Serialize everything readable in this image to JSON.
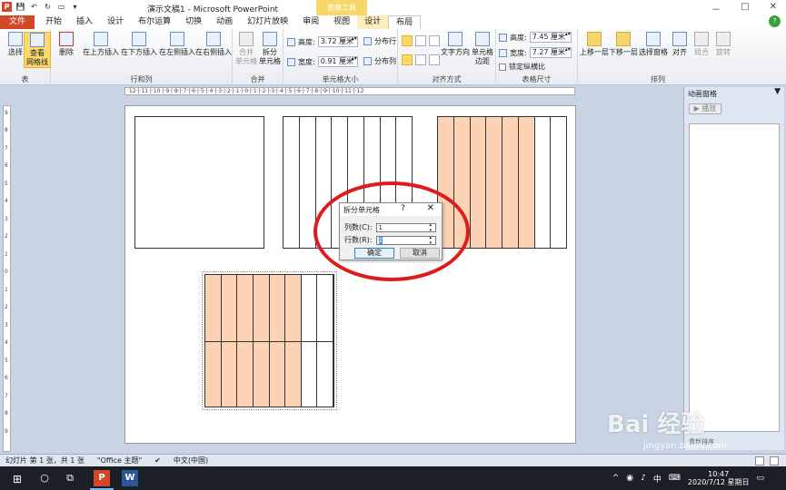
{
  "window": {
    "title": "演示文稿1 - Microsoft PowerPoint",
    "context_header": "表格工具",
    "min": "－",
    "max": "□",
    "close": "✕"
  },
  "tabs": [
    "开始",
    "插入",
    "设计",
    "布尔运算",
    "切换",
    "动画",
    "幻灯片放映",
    "审阅",
    "视图"
  ],
  "file_tab": "文件",
  "ctx_tabs": [
    "设计",
    "布局"
  ],
  "ribbon": {
    "table_group": {
      "label": "表",
      "select": "选择",
      "gridlines": "查看\n网格线"
    },
    "rowcol_group": {
      "label": "行和列",
      "delete": "删除",
      "insert_above": "在上方插入",
      "insert_below": "在下方插入",
      "insert_left": "在左侧插入",
      "insert_right": "在右侧插入"
    },
    "merge_group": {
      "label": "合并",
      "merge": "合并\n单元格",
      "split": "拆分\n单元格"
    },
    "cellsize_group": {
      "label": "单元格大小",
      "height_label": "高度:",
      "height_value": "3.72 厘米",
      "width_label": "宽度:",
      "width_value": "0.91 厘米",
      "distribute_rows": "分布行",
      "distribute_cols": "分布列"
    },
    "align_group": {
      "label": "对齐方式",
      "text_direction": "文字方向",
      "cell_margins": "单元格\n边距"
    },
    "tablesize_group": {
      "label": "表格尺寸",
      "height_label": "高度:",
      "height_value": "7.45 厘米",
      "width_label": "宽度:",
      "width_value": "7.27 厘米",
      "lock_ratio": "锁定纵横比"
    },
    "arrange_group": {
      "label": "排列",
      "bring_forward": "上移一层",
      "send_backward": "下移一层",
      "selection_pane": "选择窗格",
      "align": "对齐",
      "group": "组合",
      "rotate": "旋转"
    }
  },
  "ruler": {
    "h_text": "·12·|·11·|·10·|·9·|·8·|·7·|·6·|·5·|·4·|·3·|·2·|·1·|·0·|·1·|·2·|·3·|·4·|·5·|·6·|·7·|·8·|·9·|·10·|·11·|·12·",
    "v_labels": [
      "9",
      "8",
      "7",
      "6",
      "5",
      "4",
      "3",
      "2",
      "1",
      "0",
      "1",
      "2",
      "3",
      "4",
      "5",
      "6",
      "7",
      "8",
      "9"
    ]
  },
  "tables": [
    {
      "name": "table-1",
      "columns": 1,
      "rows": 1,
      "filled_columns": 0
    },
    {
      "name": "table-2",
      "columns": 8,
      "rows": 1,
      "filled_columns": 0
    },
    {
      "name": "table-3",
      "columns": 8,
      "rows": 1,
      "filled_columns": 6
    },
    {
      "name": "table-4",
      "columns": 8,
      "rows": 2,
      "filled_columns": 6
    }
  ],
  "dialog": {
    "title": "拆分单元格",
    "help": "?",
    "close": "✕",
    "columns_label": "列数(C):",
    "columns_value": "1",
    "rows_label": "行数(R):",
    "rows_value": "2",
    "ok": "确定",
    "cancel": "取消"
  },
  "anim_pane": {
    "title": "动画窗格",
    "play": "▶ 播放",
    "rearrange": "重新排序"
  },
  "status": {
    "slide": "幻灯片 第 1 张，共 1 张",
    "theme": "\"Office 主题\"",
    "language": "中文(中国)"
  },
  "taskbar": {
    "time": "10:47",
    "date": "2020/7/12 星期日",
    "ime": "中"
  },
  "watermark": {
    "main": "Bai 经验",
    "sub": "jingyan.baidu.com"
  },
  "colors": {
    "accent": "#d24726",
    "fill": "#fbd3b4",
    "highlight": "#e01b1b"
  }
}
